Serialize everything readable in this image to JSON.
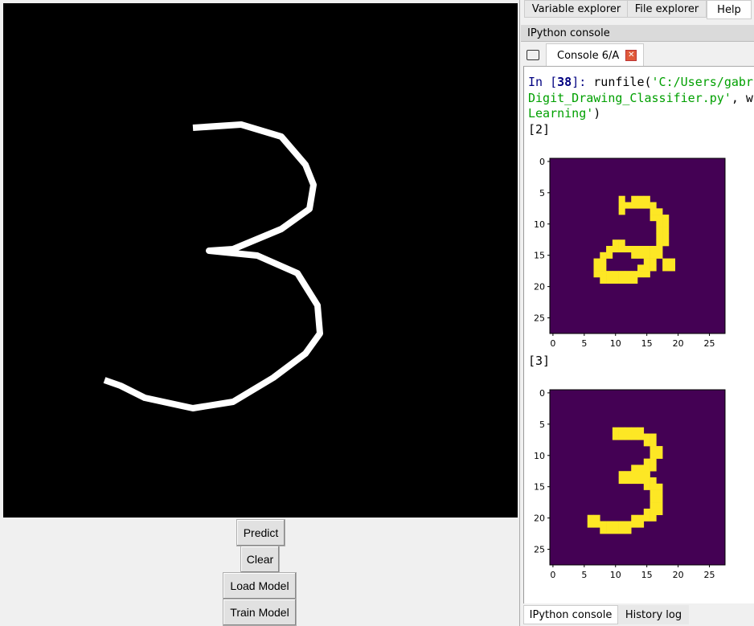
{
  "app": {
    "buttons": {
      "predict": "Predict",
      "clear": "Clear",
      "load_model": "Load Model",
      "train_model": "Train Model"
    }
  },
  "right": {
    "top_tabs": [
      "Variable explorer",
      "File explorer",
      "Help"
    ],
    "pane_title": "IPython console",
    "console_tab": "Console 6/A",
    "console": {
      "prompt": "In [",
      "prompt_num": "38",
      "prompt_end": "]: ",
      "cmd": "runfile(",
      "arg1": "'C:/Users/gabri",
      "line2": "Digit_Drawing_Classifier.py'",
      "line2_rest": ", wo",
      "line3": "Learning'",
      "line3_rest": ")",
      "out1": "[2]",
      "out2": "[3]"
    },
    "bottom_tabs": [
      "IPython console",
      "History log"
    ]
  },
  "plots": [
    {
      "label": "[2]",
      "ticks": [
        "0",
        "5",
        "10",
        "15",
        "20",
        "25"
      ],
      "cmap": {
        "bg": "#440154",
        "fg": "#fde725"
      },
      "pixels": [
        [
          6,
          [
            11,
            13,
            14,
            15
          ]
        ],
        [
          7,
          [
            11,
            12,
            13,
            14,
            15,
            16
          ]
        ],
        [
          8,
          [
            11,
            16,
            17
          ]
        ],
        [
          9,
          [
            16,
            17,
            18
          ]
        ],
        [
          10,
          [
            17,
            18
          ]
        ],
        [
          11,
          [
            17,
            18
          ]
        ],
        [
          12,
          [
            17,
            18
          ]
        ],
        [
          13,
          [
            10,
            11,
            17,
            18
          ]
        ],
        [
          14,
          [
            9,
            10,
            11,
            12,
            13,
            14,
            15,
            16,
            17
          ]
        ],
        [
          15,
          [
            8,
            9,
            13,
            14,
            15,
            16,
            17
          ]
        ],
        [
          16,
          [
            7,
            8,
            15,
            16,
            18,
            19
          ]
        ],
        [
          17,
          [
            7,
            8,
            14,
            15,
            16,
            18,
            19
          ]
        ],
        [
          18,
          [
            7,
            8,
            9,
            10,
            11,
            12,
            13,
            14,
            15
          ]
        ],
        [
          19,
          [
            8,
            9,
            10,
            11,
            12,
            13
          ]
        ]
      ]
    },
    {
      "label": "[3]",
      "ticks": [
        "0",
        "5",
        "10",
        "15",
        "20",
        "25"
      ],
      "cmap": {
        "bg": "#440154",
        "fg": "#fde725"
      },
      "pixels": [
        [
          6,
          [
            10,
            11,
            12,
            13,
            14
          ]
        ],
        [
          7,
          [
            10,
            11,
            12,
            13,
            14,
            15,
            16
          ]
        ],
        [
          8,
          [
            15,
            16
          ]
        ],
        [
          9,
          [
            16,
            17
          ]
        ],
        [
          10,
          [
            16,
            17
          ]
        ],
        [
          11,
          [
            15,
            16
          ]
        ],
        [
          12,
          [
            13,
            14,
            15,
            16
          ]
        ],
        [
          13,
          [
            11,
            12,
            13,
            14,
            15
          ]
        ],
        [
          14,
          [
            11,
            12,
            13,
            14,
            15,
            16
          ]
        ],
        [
          15,
          [
            15,
            16,
            17
          ]
        ],
        [
          16,
          [
            16,
            17
          ]
        ],
        [
          17,
          [
            16,
            17
          ]
        ],
        [
          18,
          [
            16,
            17
          ]
        ],
        [
          19,
          [
            15,
            16,
            17
          ]
        ],
        [
          20,
          [
            6,
            7,
            13,
            14,
            15,
            16
          ]
        ],
        [
          21,
          [
            6,
            7,
            8,
            9,
            10,
            11,
            12,
            13,
            14
          ]
        ],
        [
          22,
          [
            8,
            9,
            10,
            11,
            12
          ]
        ]
      ]
    }
  ]
}
